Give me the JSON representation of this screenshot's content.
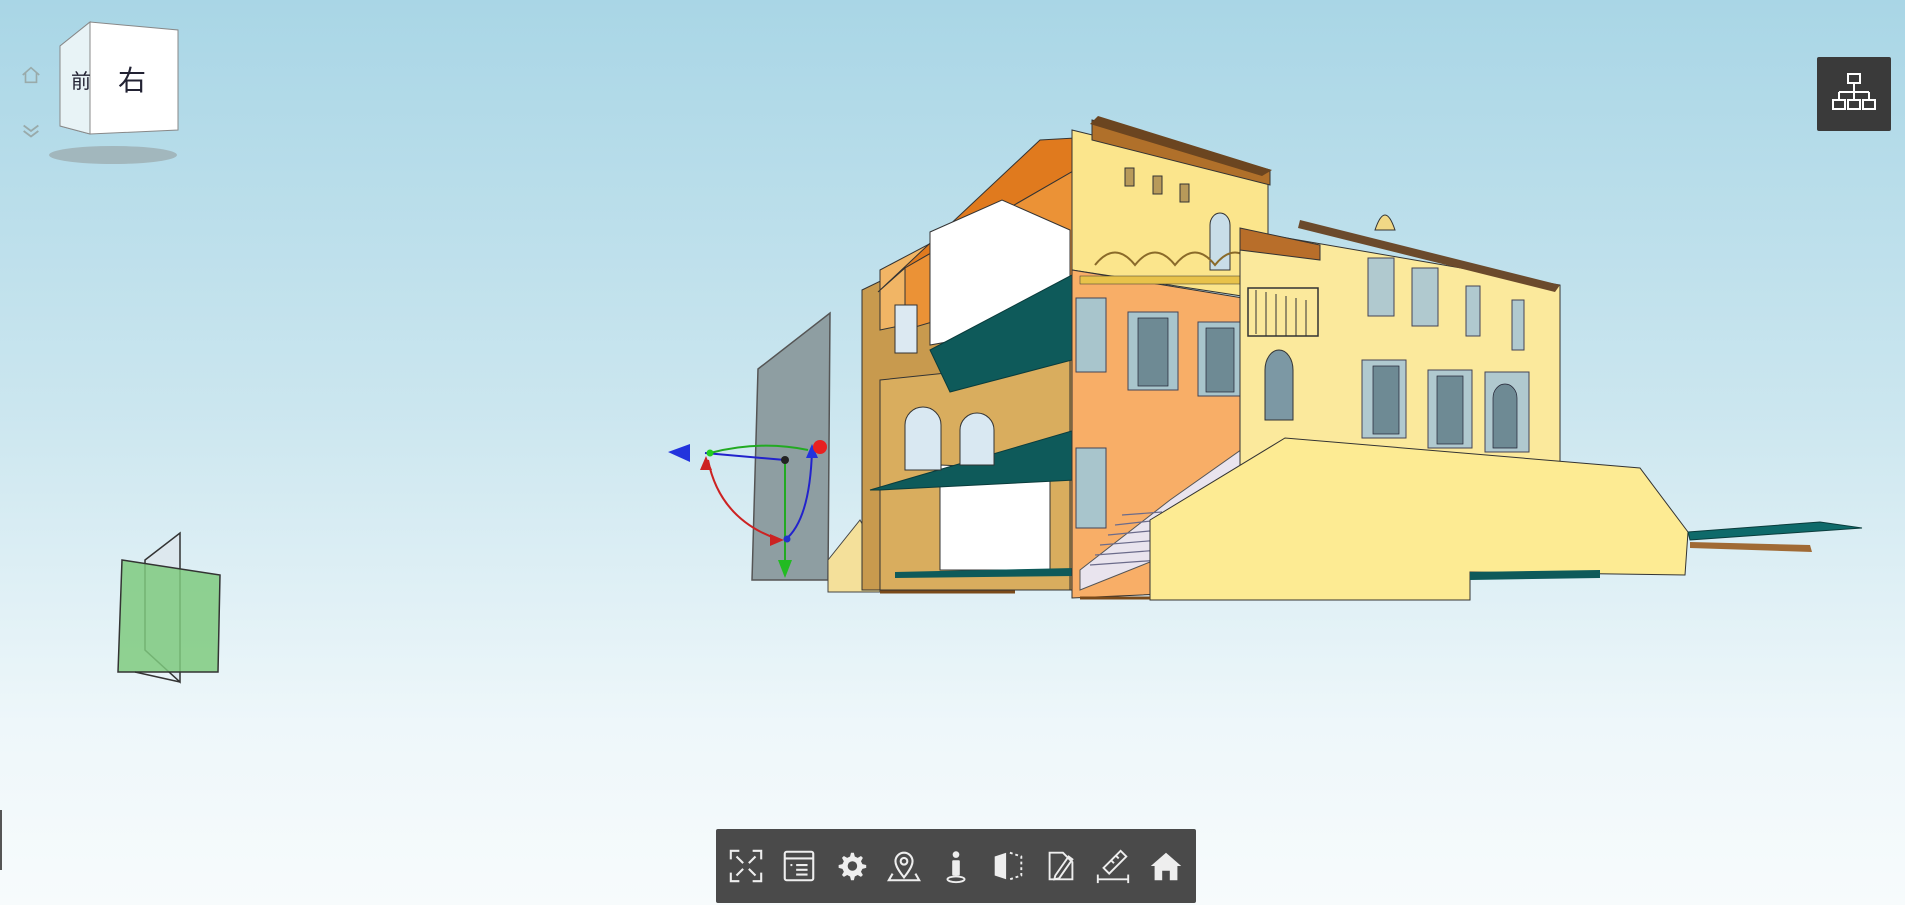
{
  "app": {
    "viewcube_faces": [
      "前",
      "右"
    ]
  },
  "toolbar": {
    "buttons": [
      {
        "name": "fit-view",
        "icon": "fit-to-view-icon"
      },
      {
        "name": "model-browser",
        "icon": "document-list-icon"
      },
      {
        "name": "settings",
        "icon": "gear-icon"
      },
      {
        "name": "location",
        "icon": "map-pin-icon"
      },
      {
        "name": "properties",
        "icon": "info-person-icon"
      },
      {
        "name": "section",
        "icon": "section-plane-icon"
      },
      {
        "name": "markup",
        "icon": "pencil-markup-icon"
      },
      {
        "name": "measure",
        "icon": "ruler-measure-icon"
      },
      {
        "name": "home",
        "icon": "home-icon"
      }
    ]
  },
  "colors": {
    "toolbar_bg": "#4a4a4a",
    "hierarchy_bg": "#3a3a3a",
    "sky_top": "#a9d6e6",
    "sky_bottom": "#f7fbfc",
    "wall_yellow": "#fbe89a",
    "wall_orange": "#f7ae6a",
    "roof_orange": "#e07a1e",
    "slab_teal": "#0e5a5a",
    "section_plane": "#8fa0a4",
    "section_box_green": "#7cc77c"
  }
}
